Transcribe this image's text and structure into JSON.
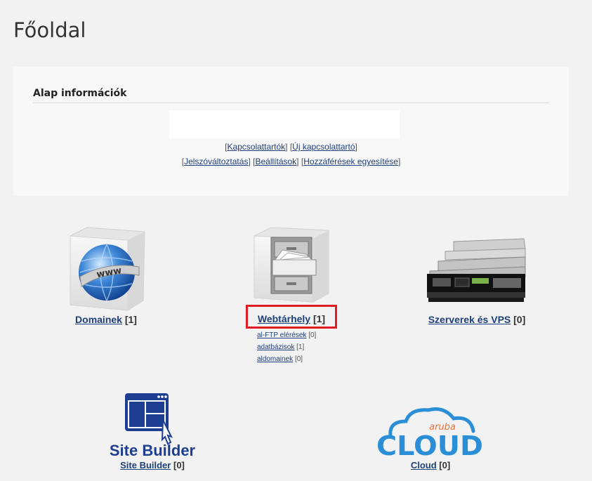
{
  "page_title": "Főoldal",
  "info": {
    "heading": "Alap információk",
    "links_row1": [
      "Kapcsolattartók",
      "Új kapcsolattartó"
    ],
    "links_row2": [
      "Jelszóváltoztatás",
      "Beállítások",
      "Hozzáférések egyesítése"
    ]
  },
  "services": {
    "domains": {
      "label": "Domainek",
      "count": "[1]",
      "icon": "globe-www-icon"
    },
    "hosting": {
      "label": "Webtárhely",
      "count": "[1]",
      "icon": "file-cabinet-icon",
      "sub": [
        {
          "label": "al-FTP elérések",
          "count": "[0]"
        },
        {
          "label": "adatbázisok",
          "count": "[1]"
        },
        {
          "label": "aldomainek",
          "count": "[0]"
        }
      ]
    },
    "servers": {
      "label": "Szerverek és VPS",
      "count": "[0]",
      "icon": "server-rack-icon"
    },
    "sitebuilder": {
      "label": "Site Builder",
      "count": "[0]",
      "logo_text": "Site Builder",
      "icon": "site-builder-icon"
    },
    "cloud": {
      "label": "Cloud",
      "count": "[0]",
      "logo_text": "CLOUD",
      "logo_brand": "aruba",
      "icon": "aruba-cloud-icon"
    }
  },
  "colors": {
    "link": "#1f3f7a",
    "highlight": "#e01b24",
    "brand_blue": "#1e3f91",
    "cloud_blue": "#2a8fd6",
    "aruba_orange": "#e8743b"
  }
}
